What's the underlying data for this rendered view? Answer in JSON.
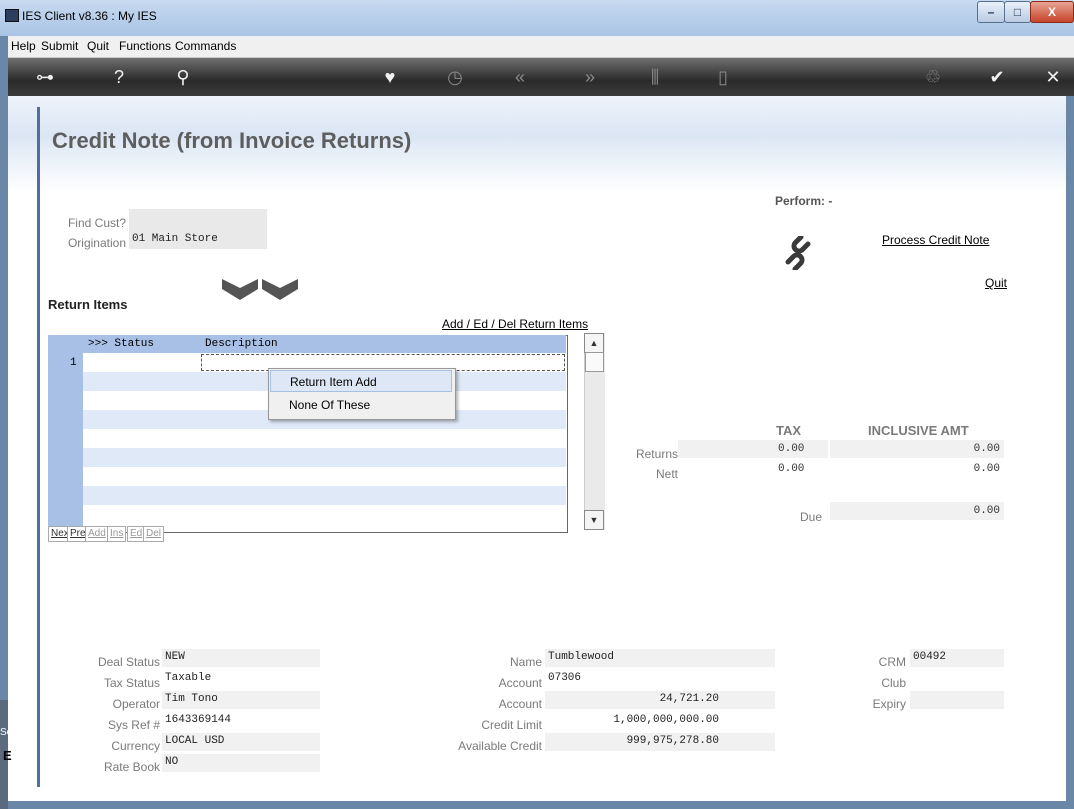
{
  "window": {
    "title": "IES Client v8.36 : My IES",
    "controls": {
      "minimize": "–",
      "maximize": "□",
      "close": "X"
    }
  },
  "menu": [
    "Help",
    "Submit",
    "Quit",
    "Functions",
    "Commands"
  ],
  "toolbar": {
    "icons": [
      "key-icon",
      "help-icon",
      "search-icon",
      "heart-icon",
      "clock-icon",
      "rewind-icon",
      "forward-icon",
      "tools-icon",
      "document-icon",
      "recycle-icon",
      "check-icon",
      "close-icon"
    ],
    "glyphs": {
      "key": "⊶",
      "help": "?",
      "search": "⚲",
      "heart": "♥",
      "clock": "◷",
      "rewind": "«",
      "forward": "»",
      "tools": "⫼",
      "document": "▯",
      "recycle": "♲",
      "check": "✔",
      "close": "✕"
    }
  },
  "page": {
    "title": "Credit Note (from Invoice Returns)"
  },
  "form": {
    "find_cust_label": "Find Cust?",
    "find_cust_value": "",
    "origination_label": "Origination",
    "origination_value": "01 Main Store"
  },
  "perform": {
    "label": "Perform: -",
    "process_link": "Process Credit Note",
    "quit_link": "Quit"
  },
  "return_items": {
    "heading": "Return Items",
    "edit_link": "Add / Ed / Del Return Items",
    "columns": [
      ">>> Status",
      "Description"
    ],
    "row_number": "1",
    "nav_buttons": [
      "Nex",
      "Pre",
      "Add",
      "Ins",
      "Ed",
      "Del"
    ]
  },
  "popup_menu": {
    "items": [
      "Return Item Add",
      "None Of These"
    ]
  },
  "totals": {
    "tax_header": "TAX",
    "amt_header": "INCLUSIVE AMT",
    "returns_label": "Returns",
    "returns_tax": "0.00",
    "returns_amt": "0.00",
    "nett_label": "Nett",
    "nett_tax": "0.00",
    "nett_amt": "0.00",
    "due_label": "Due",
    "due_amt": "0.00"
  },
  "deal": {
    "deal_status_label": "Deal Status",
    "deal_status": "NEW",
    "tax_status_label": "Tax Status",
    "tax_status": "Taxable",
    "operator_label": "Operator",
    "operator": "Tim Tono",
    "sys_ref_label": "Sys Ref #",
    "sys_ref": "1643369144",
    "currency_label": "Currency",
    "currency": "LOCAL USD",
    "rate_book_label": "Rate Book",
    "rate_book": "NO"
  },
  "customer": {
    "name_label": "Name",
    "name": "Tumblewood",
    "account_label": "Account",
    "account": "07306",
    "account_bal_label": "Account",
    "account_bal": "24,721.20",
    "credit_limit_label": "Credit Limit",
    "credit_limit": "1,000,000,000.00",
    "available_label": "Available Credit",
    "available": "999,975,278.80"
  },
  "crm": {
    "crm_label": "CRM",
    "crm": "00492",
    "club_label": "Club",
    "club": "",
    "expiry_label": "Expiry",
    "expiry": ""
  },
  "side_fragment": {
    "text": "Ses",
    "glyph": "E"
  }
}
